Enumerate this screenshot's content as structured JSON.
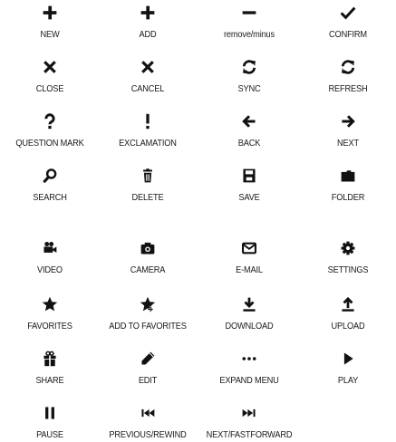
{
  "icons": [
    {
      "icon": "plus-icon",
      "label": "NEW"
    },
    {
      "icon": "plus-icon",
      "label": "ADD"
    },
    {
      "icon": "minus-icon",
      "label": "remove/minus"
    },
    {
      "icon": "check-icon",
      "label": "CONFIRM"
    },
    {
      "icon": "close-icon",
      "label": "CLOSE"
    },
    {
      "icon": "close-icon",
      "label": "CANCEL"
    },
    {
      "icon": "sync-icon",
      "label": "SYNC"
    },
    {
      "icon": "sync-icon",
      "label": "REFRESH"
    },
    {
      "icon": "question-icon",
      "label": "QUESTION MARK"
    },
    {
      "icon": "exclamation-icon",
      "label": "EXCLAMATION"
    },
    {
      "icon": "arrow-left-icon",
      "label": "BACK"
    },
    {
      "icon": "arrow-right-icon",
      "label": "NEXT"
    },
    {
      "icon": "search-icon",
      "label": "SEARCH"
    },
    {
      "icon": "trash-icon",
      "label": "DELETE"
    },
    {
      "icon": "save-icon",
      "label": "SAVE"
    },
    {
      "icon": "folder-icon",
      "label": "FOLDER"
    },
    {
      "icon": "video-icon",
      "label": "VIDEO"
    },
    {
      "icon": "camera-icon",
      "label": "CAMERA"
    },
    {
      "icon": "envelope-icon",
      "label": "E-MAIL"
    },
    {
      "icon": "gear-icon",
      "label": "SETTINGS"
    },
    {
      "icon": "star-icon",
      "label": "FAVORITES"
    },
    {
      "icon": "star-add-icon",
      "label": "ADD TO FAVORITES"
    },
    {
      "icon": "download-icon",
      "label": "DOWNLOAD"
    },
    {
      "icon": "upload-icon",
      "label": "UPLOAD"
    },
    {
      "icon": "gift-icon",
      "label": "SHARE"
    },
    {
      "icon": "pencil-icon",
      "label": "EDIT"
    },
    {
      "icon": "ellipsis-icon",
      "label": "EXPAND MENU"
    },
    {
      "icon": "play-icon",
      "label": "PLAY"
    },
    {
      "icon": "pause-icon",
      "label": "PAUSE"
    },
    {
      "icon": "rewind-icon",
      "label": "PREVIOUS/REWIND"
    },
    {
      "icon": "fastforward-icon",
      "label": "NEXT/FASTFORWARD"
    }
  ]
}
